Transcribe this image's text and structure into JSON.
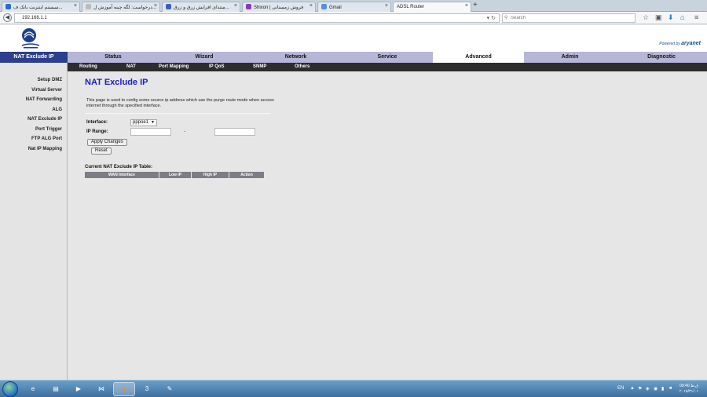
{
  "browser": {
    "tabs": [
      {
        "label": "سیستم اینترنت بانک ف...",
        "active": false,
        "color": "#2a6ad4"
      },
      {
        "label": "درخواست: لگه چینه آموزش ل...",
        "active": false,
        "color": "#bbb"
      },
      {
        "label": "منتدای افزایش زرق و زرق...",
        "active": false,
        "color": "#3b5fc0"
      },
      {
        "label": "Shixon | فروش زمستانی",
        "active": false,
        "color": "#8a3ab8"
      },
      {
        "label": "Gmail",
        "active": false,
        "color": "#5a8de0"
      },
      {
        "label": "ADSL Router",
        "active": true,
        "color": "#fff"
      }
    ],
    "new_tab": "+",
    "url": "192.168.1.1",
    "search_placeholder": "Search"
  },
  "router": {
    "powered_prefix": "Powered by",
    "powered_brand": "aryanet"
  },
  "mainnav": {
    "title": "NAT Exclude IP",
    "items": [
      {
        "label": "Status",
        "active": false
      },
      {
        "label": "Wizard",
        "active": false
      },
      {
        "label": "Network",
        "active": false
      },
      {
        "label": "Service",
        "active": false
      },
      {
        "label": "Advanced",
        "active": true
      },
      {
        "label": "Admin",
        "active": false
      },
      {
        "label": "Diagnostic",
        "active": false
      }
    ]
  },
  "subnav": [
    "Routing",
    "NAT",
    "Port Mapping",
    "IP QoS",
    "SNMP",
    "Others"
  ],
  "sidebar": [
    "Setup DMZ",
    "Virtual Server",
    "NAT Forwarding",
    "ALG",
    "NAT Exclude IP",
    "Port Trigger",
    "FTP ALG Port",
    "Nat IP Mapping"
  ],
  "content": {
    "title": "NAT Exclude IP",
    "description": "This page is used to config some source ip address which use the purge route mode when access internet through the specified interface.",
    "interface_label": "Interface:",
    "interface_value": "pppoe1",
    "ip_range_label": "IP Range:",
    "range_separator": "-",
    "apply_button": "Apply Changes",
    "reset_button": "Reset",
    "table_title": "Current NAT Exclude IP Table:",
    "table_headers": [
      "WAN Interface",
      "Low IP",
      "High IP",
      "Action"
    ]
  },
  "taskbar": {
    "apps": [
      {
        "name": "ie",
        "glyph": "e"
      },
      {
        "name": "explorer",
        "glyph": "▤"
      },
      {
        "name": "media",
        "glyph": "▶"
      },
      {
        "name": "app4",
        "glyph": "⋈"
      },
      {
        "name": "firefox",
        "glyph": "●"
      },
      {
        "name": "app6",
        "glyph": "3"
      },
      {
        "name": "app7",
        "glyph": "✎"
      }
    ],
    "lang": "EN",
    "time": "09:40 ق.ظ",
    "date": "۲۰۱۵/۳۱/۰۱"
  }
}
